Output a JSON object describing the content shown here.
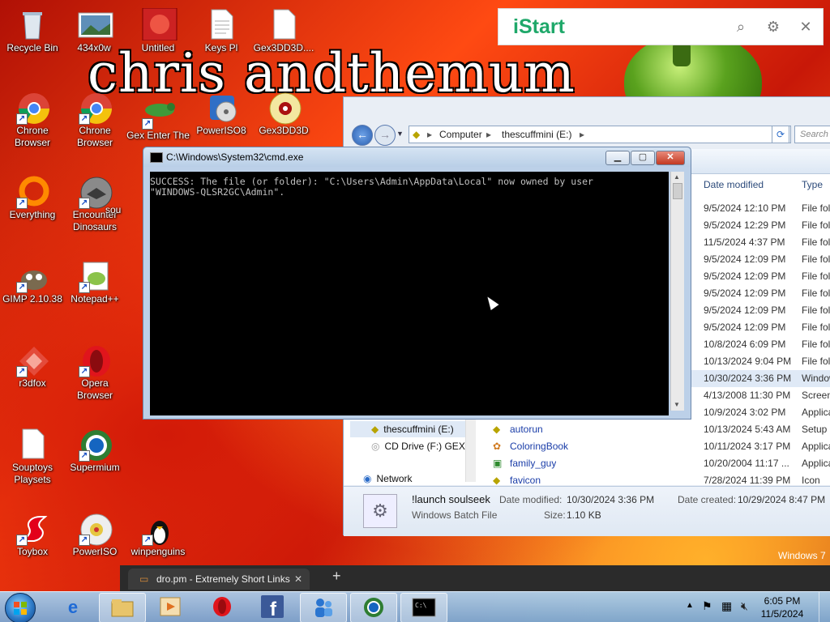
{
  "wallpaper": {
    "text": "chris andthemum"
  },
  "desktop_icons": [
    {
      "label": "Recycle Bin",
      "icon": "recycle-bin-icon"
    },
    {
      "label": "434x0w",
      "icon": "image-icon"
    },
    {
      "label": "Untitled",
      "icon": "image-icon"
    },
    {
      "label": "Keys Pl",
      "icon": "text-file-icon"
    },
    {
      "label": "Gex3DD3D....",
      "icon": "file-icon"
    },
    {
      "label": "Chrone Browser",
      "icon": "chrome-icon"
    },
    {
      "label": "Chrone Browser",
      "icon": "chrome-icon"
    },
    {
      "label": "Gex Enter The",
      "icon": "gecko-icon"
    },
    {
      "label": "PowerISO8",
      "icon": "poweriso-icon"
    },
    {
      "label": "Gex3DD3D",
      "icon": "disc-icon"
    },
    {
      "label": "Everything",
      "icon": "everything-icon"
    },
    {
      "label": "Encounter Dinosaurs",
      "icon": "dinosaur-icon"
    },
    {
      "label": "sou",
      "icon": "file-icon"
    },
    {
      "label": "GIMP 2.10.38",
      "icon": "gimp-icon"
    },
    {
      "label": "Notepad++",
      "icon": "notepadpp-icon"
    },
    {
      "label": "r3dfox",
      "icon": "r3dfox-icon"
    },
    {
      "label": "Opera Browser",
      "icon": "opera-icon"
    },
    {
      "label": "Souptoys Playsets",
      "icon": "blank-file-icon"
    },
    {
      "label": "Supermium",
      "icon": "supermium-icon"
    },
    {
      "label": "Toybox",
      "icon": "toybox-icon"
    },
    {
      "label": "PowerISO",
      "icon": "disc-icon"
    },
    {
      "label": "winpenguins",
      "icon": "penguin-icon"
    }
  ],
  "istart": {
    "logo": "iStart"
  },
  "explorer": {
    "breadcrumb": [
      "Computer",
      "thescuffmini (E:)"
    ],
    "search_placeholder": "Search th",
    "columns": {
      "date": "Date modified",
      "type": "Type"
    },
    "rows": [
      {
        "date": "9/5/2024 12:10 PM",
        "type": "File fold"
      },
      {
        "date": "9/5/2024 12:29 PM",
        "type": "File fold"
      },
      {
        "date": "11/5/2024 4:37 PM",
        "type": "File fold"
      },
      {
        "date": "9/5/2024 12:09 PM",
        "type": "File fold"
      },
      {
        "date": "9/5/2024 12:09 PM",
        "type": "File fold"
      },
      {
        "date": "9/5/2024 12:09 PM",
        "type": "File fold"
      },
      {
        "date": "9/5/2024 12:09 PM",
        "type": "File fold"
      },
      {
        "date": "9/5/2024 12:09 PM",
        "type": "File fold"
      },
      {
        "date": "10/8/2024 6:09 PM",
        "type": "File fold"
      },
      {
        "date": "10/13/2024 9:04 PM",
        "type": "File fold"
      },
      {
        "date": "10/30/2024 3:36 PM",
        "type": "Window"
      },
      {
        "date": "4/13/2008 11:30 PM",
        "type": "Screen"
      },
      {
        "date": "10/9/2024 3:02 PM",
        "type": "Applica"
      },
      {
        "date": "10/13/2024 5:43 AM",
        "name": "autorun",
        "type": "Setup In"
      },
      {
        "date": "10/11/2024 3:17 PM",
        "name": "ColoringBook",
        "type": "Applica"
      },
      {
        "date": "10/20/2004 11:17 ...",
        "name": "family_guy",
        "type": "Applica"
      },
      {
        "date": "7/28/2024 11:39 PM",
        "name": "favicon",
        "type": "Icon"
      }
    ],
    "nav": [
      {
        "label": "thescuffmini (E:)"
      },
      {
        "label": "CD Drive (F:) GEX"
      },
      {
        "label": "Network"
      }
    ],
    "details": {
      "name": "!launch soulseek",
      "type": "Windows Batch File",
      "modified_label": "Date modified:",
      "modified": "10/30/2024 3:36 PM",
      "size_label": "Size:",
      "size": "1.10 KB",
      "created_label": "Date created:",
      "created": "10/29/2024 8:47 PM"
    }
  },
  "cmd": {
    "title": "C:\\Windows\\System32\\cmd.exe",
    "output": "SUCCESS: The file (or folder): \"C:\\Users\\Admin\\AppData\\Local\" now owned by user\n\"WINDOWS-QLSR2GC\\Admin\"."
  },
  "browser_tab": {
    "title": "dro.pm - Extremely Short Links",
    "close": "✕",
    "new_tab": "+"
  },
  "watermark": "Windows 7",
  "taskbar": {
    "items": [
      "start-button",
      "ie",
      "explorer",
      "media",
      "opera",
      "facebook",
      "people",
      "supermium",
      "cmd"
    ],
    "clock": {
      "time": "6:05 PM",
      "date": "11/5/2024"
    }
  },
  "colors": {
    "istart_green": "#1fa86a",
    "cmd_bg": "#000000",
    "cmd_text": "#c0c0c0",
    "link_blue": "#1a3da8"
  }
}
